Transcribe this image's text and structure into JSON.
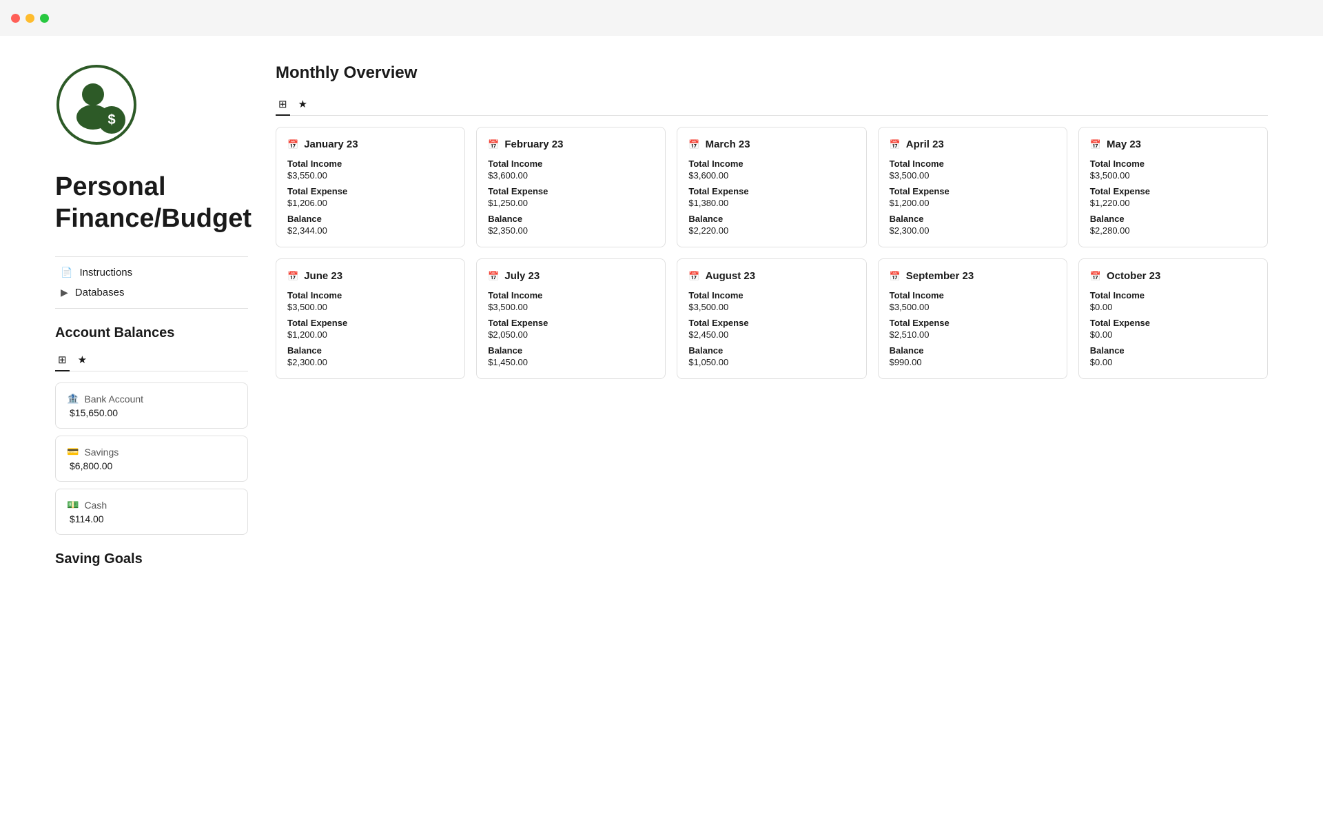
{
  "titlebar": {
    "close_color": "#ff5f57",
    "minimize_color": "#febc2e",
    "maximize_color": "#28c840"
  },
  "sidebar": {
    "page_title": "Personal Finance/Budget",
    "nav_items": [
      {
        "id": "instructions",
        "icon": "📄",
        "label": "Instructions"
      },
      {
        "id": "databases",
        "icon": "▶",
        "label": "Databases"
      }
    ],
    "account_balances_title": "Account Balances",
    "view_toggle": [
      {
        "icon": "⊞",
        "label": ""
      },
      {
        "icon": "★",
        "label": ""
      }
    ],
    "accounts": [
      {
        "id": "bank",
        "icon": "🏦",
        "label": "Bank Account",
        "value": "$15,650.00"
      },
      {
        "id": "savings",
        "icon": "💳",
        "label": "Savings",
        "value": "$6,800.00"
      },
      {
        "id": "cash",
        "icon": "💵",
        "label": "Cash",
        "value": "$114.00"
      }
    ],
    "saving_goals_title": "Saving Goals"
  },
  "content": {
    "header": "Monthly Overview",
    "view_toggle": [
      {
        "icon": "⊞",
        "label": ""
      },
      {
        "icon": "★",
        "label": ""
      }
    ],
    "months": [
      {
        "id": "jan23",
        "name": "January 23",
        "total_income_label": "Total Income",
        "total_income": "$3,550.00",
        "total_expense_label": "Total Expense",
        "total_expense": "$1,206.00",
        "balance_label": "Balance",
        "balance": "$2,344.00"
      },
      {
        "id": "feb23",
        "name": "February 23",
        "total_income_label": "Total Income",
        "total_income": "$3,600.00",
        "total_expense_label": "Total Expense",
        "total_expense": "$1,250.00",
        "balance_label": "Balance",
        "balance": "$2,350.00"
      },
      {
        "id": "mar23",
        "name": "March 23",
        "total_income_label": "Total Income",
        "total_income": "$3,600.00",
        "total_expense_label": "Total Expense",
        "total_expense": "$1,380.00",
        "balance_label": "Balance",
        "balance": "$2,220.00"
      },
      {
        "id": "apr23",
        "name": "April 23",
        "total_income_label": "Total Income",
        "total_income": "$3,500.00",
        "total_expense_label": "Total Expense",
        "total_expense": "$1,200.00",
        "balance_label": "Balance",
        "balance": "$2,300.00"
      },
      {
        "id": "may23",
        "name": "May 23",
        "total_income_label": "Total Income",
        "total_income": "$3,500.00",
        "total_expense_label": "Total Expense",
        "total_expense": "$1,220.00",
        "balance_label": "Balance",
        "balance": "$2,280.00"
      },
      {
        "id": "jun23",
        "name": "June 23",
        "total_income_label": "Total Income",
        "total_income": "$3,500.00",
        "total_expense_label": "Total Expense",
        "total_expense": "$1,200.00",
        "balance_label": "Balance",
        "balance": "$2,300.00"
      },
      {
        "id": "jul23",
        "name": "July 23",
        "total_income_label": "Total Income",
        "total_income": "$3,500.00",
        "total_expense_label": "Total Expense",
        "total_expense": "$2,050.00",
        "balance_label": "Balance",
        "balance": "$1,450.00"
      },
      {
        "id": "aug23",
        "name": "August 23",
        "total_income_label": "Total Income",
        "total_income": "$3,500.00",
        "total_expense_label": "Total Expense",
        "total_expense": "$2,450.00",
        "balance_label": "Balance",
        "balance": "$1,050.00"
      },
      {
        "id": "sep23",
        "name": "September 23",
        "total_income_label": "Total Income",
        "total_income": "$3,500.00",
        "total_expense_label": "Total Expense",
        "total_expense": "$2,510.00",
        "balance_label": "Balance",
        "balance": "$990.00"
      },
      {
        "id": "oct23",
        "name": "October 23",
        "total_income_label": "Total Income",
        "total_income": "$0.00",
        "total_expense_label": "Total Expense",
        "total_expense": "$0.00",
        "balance_label": "Balance",
        "balance": "$0.00"
      }
    ]
  }
}
